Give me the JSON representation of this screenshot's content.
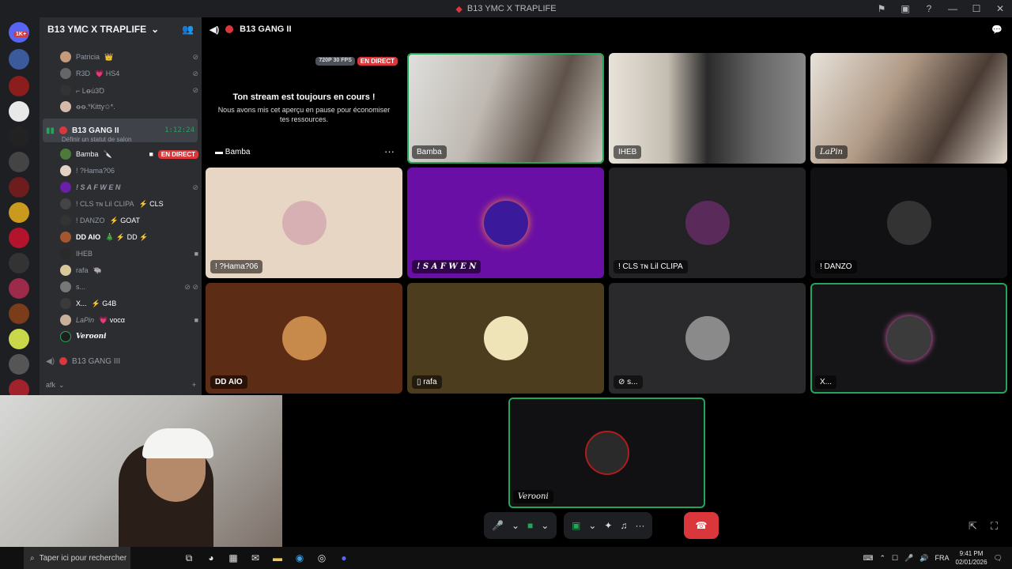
{
  "window": {
    "title": "B13 YMC X TRAPLIFE"
  },
  "server": {
    "name": "B13 YMC X TRAPLIFE"
  },
  "voice_users_above": [
    {
      "name": "Patricia",
      "tag": "👑"
    },
    {
      "name": "R3D",
      "tag": "💗 HS4"
    },
    {
      "name": "⌐ Lꝋú3Ꝺ",
      "tag": ""
    },
    {
      "name": "ꝋꝋ.*Kitty✩*.",
      "tag": ""
    }
  ],
  "active_channel": {
    "name": "B13 GANG II",
    "timer": "1:12:24",
    "status_placeholder": "Définir un statut de salon"
  },
  "channel_users": [
    {
      "name": "Bamba",
      "tag": "🔪",
      "live": "EN DIRECT"
    },
    {
      "name": "! ?Hama?06",
      "tag": ""
    },
    {
      "name": "! S A F W E N",
      "tag": ""
    },
    {
      "name": "! CLS ᴛɴ Lil CLIPA",
      "tag": "⚡ CLS"
    },
    {
      "name": "! DANZO",
      "tag": "⚡ GOAT"
    },
    {
      "name": "DD AIO",
      "tag": "🎄 ⚡ DD ⚡"
    },
    {
      "name": "IHEB",
      "tag": ""
    },
    {
      "name": "rafa",
      "tag": "🐃"
    },
    {
      "name": "s...",
      "tag": ""
    },
    {
      "name": "X...",
      "tag": "⚡ G4B"
    },
    {
      "name": "LaPin",
      "tag": "💗 vocα"
    },
    {
      "name": "Verooni",
      "tag": ""
    }
  ],
  "other_channel": {
    "name": "B13 GANG III"
  },
  "category": {
    "name": "afk"
  },
  "call": {
    "channel_name": "B13 GANG II",
    "stream_quality": "720P 30 FPS",
    "live_badge": "EN DIRECT",
    "paused_title": "Ton stream est toujours en cours !",
    "paused_text": "Nous avons mis cet aperçu en pause pour économiser tes ressources.",
    "stream_owner": "Bamba"
  },
  "tiles": [
    {
      "name": "Bamba",
      "type": "video"
    },
    {
      "name": "IHEB",
      "type": "video"
    },
    {
      "name": "LaPin",
      "type": "video"
    },
    {
      "name": "! ?Hama?06",
      "type": "avatar"
    },
    {
      "name": "! S A F W E N",
      "type": "avatar"
    },
    {
      "name": "! CLS ᴛɴ Lil CLIPA",
      "type": "avatar"
    },
    {
      "name": "! DANZO",
      "type": "avatar"
    },
    {
      "name": "DD AIO",
      "type": "avatar"
    },
    {
      "name": "rafa",
      "type": "avatar"
    },
    {
      "name": "s...",
      "type": "avatar"
    },
    {
      "name": "X...",
      "type": "avatar"
    },
    {
      "name": "Verooni",
      "type": "avatar"
    }
  ],
  "guild_badge": "1K+",
  "taskbar": {
    "search_placeholder": "Taper ici pour rechercher",
    "lang": "FRA",
    "time": "9:41 PM",
    "date": "02/01/2026"
  }
}
